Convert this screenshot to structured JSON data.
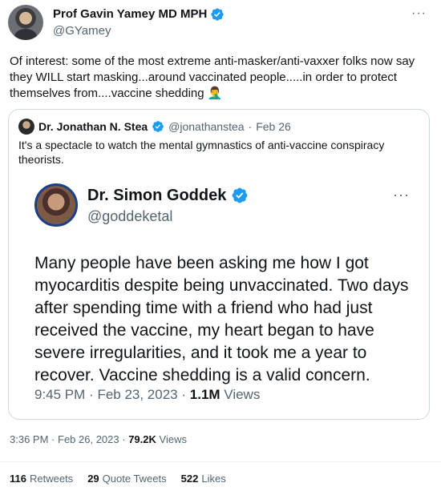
{
  "main_tweet": {
    "author_name": "Prof Gavin Yamey MD MPH",
    "author_handle": "@GYamey",
    "text": "Of interest: some of the most extreme anti-masker/anti-vaxxer folks now say they WILL start masking...around vaccinated people.....in order to protect themselves from....vaccine shedding 🤦‍♂️",
    "time": "3:36 PM",
    "date": "Feb 26, 2023",
    "views_count": "79.2K",
    "views_label": "Views"
  },
  "quoted_tweet": {
    "author_name": "Dr. Jonathan N. Stea",
    "author_handle": "@jonathanstea",
    "date": "Feb 26",
    "text": "It's a spectacle to watch the mental gymnastics of anti-vaccine conspiracy theorists."
  },
  "embedded_tweet": {
    "author_name": "Dr. Simon Goddek",
    "author_handle": "@goddeketal",
    "text": "Many people have been asking me how I got myocarditis despite being unvaccinated. Two days after spending time with a friend who had just received the vaccine, my heart began to have severe irregularities, and it took me a year to recover. Vaccine shedding is a valid concern.",
    "time": "9:45 PM",
    "date": "Feb 23, 2023",
    "views_count": "1.1M",
    "views_label": "Views"
  },
  "stats": {
    "retweets_count": "116",
    "retweets_label": "Retweets",
    "quotes_count": "29",
    "quotes_label": "Quote Tweets",
    "likes_count": "522",
    "likes_label": "Likes"
  },
  "icons": {
    "more": "more-icon",
    "verified": "verified-icon"
  },
  "colors": {
    "verified_blue": "#1d9bf0",
    "secondary_text": "#536471",
    "border": "#cfd9de"
  }
}
